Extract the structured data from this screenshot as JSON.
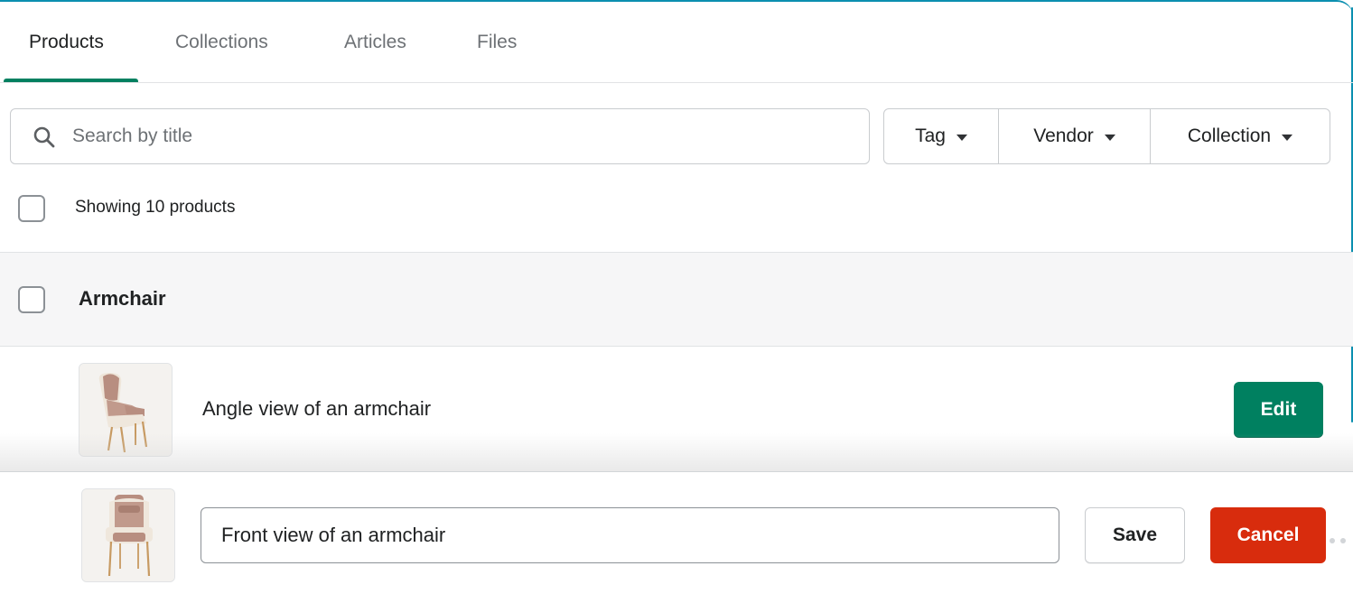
{
  "tabs": [
    {
      "label": "Products",
      "active": true
    },
    {
      "label": "Collections",
      "active": false
    },
    {
      "label": "Articles",
      "active": false
    },
    {
      "label": "Files",
      "active": false
    }
  ],
  "search": {
    "placeholder": "Search by title",
    "value": "",
    "icon": "search-icon"
  },
  "filters": [
    {
      "label": "Tag",
      "icon": "caret-down-icon"
    },
    {
      "label": "Vendor",
      "icon": "caret-down-icon"
    },
    {
      "label": "Collection",
      "icon": "caret-down-icon"
    }
  ],
  "listing": {
    "showing_text": "Showing 10 products"
  },
  "product": {
    "title": "Armchair",
    "images": [
      {
        "alt": "Angle view of an armchair",
        "action_label": "Edit"
      }
    ]
  },
  "editor": {
    "value": "Front view of an armchair",
    "save_label": "Save",
    "cancel_label": "Cancel"
  },
  "colors": {
    "accent": "#008060",
    "danger": "#d82c0d",
    "frame": "#0b8fb0",
    "chair_upholstery": "#b88e80",
    "chair_shell": "#efe7dc"
  }
}
